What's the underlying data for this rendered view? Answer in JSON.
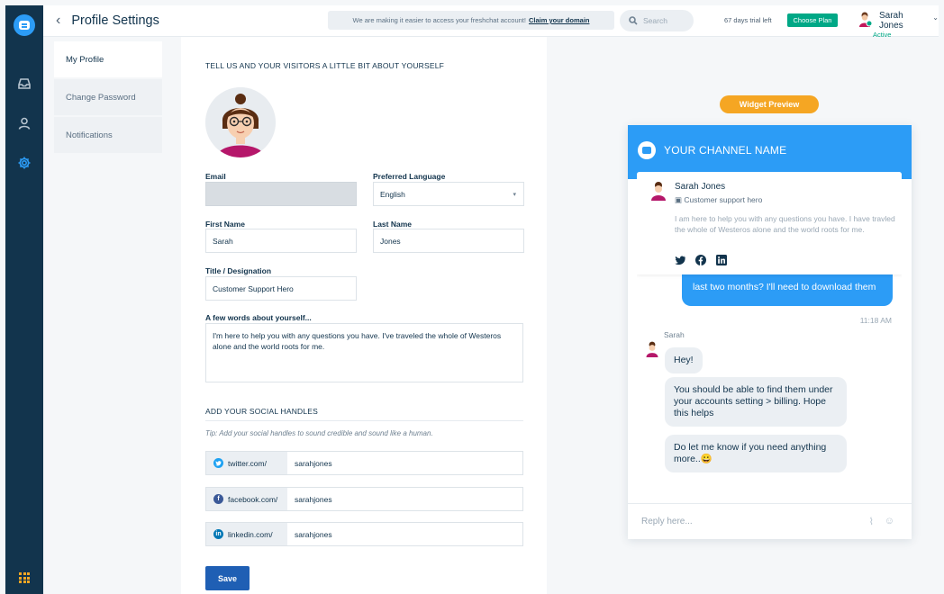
{
  "header": {
    "back_icon": "chevron-left",
    "title": "Profile Settings",
    "banner_text": "We are making it easier to access your freshchat account!",
    "banner_link": "Claim your domain",
    "search_placeholder": "Search",
    "trial_text": "67 days trial left",
    "plan_button": "Choose Plan",
    "user_name": "Sarah Jones",
    "user_status": "Active"
  },
  "rail": {
    "items": [
      "logo-icon",
      "inbox-icon",
      "contacts-icon",
      "settings-icon",
      "apps-grid-icon"
    ],
    "active": "settings-icon",
    "accent": "#2c9cf6"
  },
  "subnav": {
    "items": [
      {
        "label": "My Profile",
        "active": true
      },
      {
        "label": "Change Password",
        "active": false
      },
      {
        "label": "Notifications",
        "active": false
      }
    ]
  },
  "form": {
    "intro_heading": "TELL US AND YOUR VISITORS A LITTLE BIT ABOUT YOURSELF",
    "email_label": "Email",
    "language_label": "Preferred Language",
    "language_value": "English",
    "first_name_label": "First Name",
    "first_name_value": "Sarah",
    "last_name_label": "Last Name",
    "last_name_value": "Jones",
    "title_label": "Title / Designation",
    "title_value": "Customer Support Hero",
    "about_label": "A few words about yourself...",
    "about_value": "I'm here to help you with any questions you have. I've traveled the whole of Westeros alone and the world roots for me.",
    "social_heading": "ADD YOUR SOCIAL HANDLES",
    "social_tip": "Tip: Add your social handles to sound credible and sound like a human.",
    "socials": [
      {
        "prefix": "twitter.com/",
        "value": "sarahjones",
        "color": "#1da1f2",
        "icon": "twitter-icon"
      },
      {
        "prefix": "facebook.com/",
        "value": "sarahjones",
        "color": "#3b5998",
        "icon": "facebook-icon"
      },
      {
        "prefix": "linkedin.com/",
        "value": "sarahjones",
        "color": "#0077b5",
        "icon": "linkedin-icon"
      }
    ],
    "save_button": "Save",
    "primary_color": "#1f5fb4"
  },
  "widget": {
    "preview_pill": "Widget Preview",
    "channel_name": "YOUR CHANNEL NAME",
    "header_color": "#2c9cf6",
    "agent_name": "Sarah Jones",
    "agent_role": "Customer support hero",
    "agent_bio": "I am here to help you with any questions you have. I have travled the whole of Westeros alone and the world roots for me.",
    "outgoing_message": "last two months? I'll need to download them",
    "message_time": "11:18 AM",
    "sender_name": "Sarah",
    "replies": [
      "Hey!",
      "You should be able to find them under your accounts setting > billing. Hope this helps",
      "Do let me know if you need anything more..😀"
    ],
    "reply_placeholder": "Reply here..."
  }
}
